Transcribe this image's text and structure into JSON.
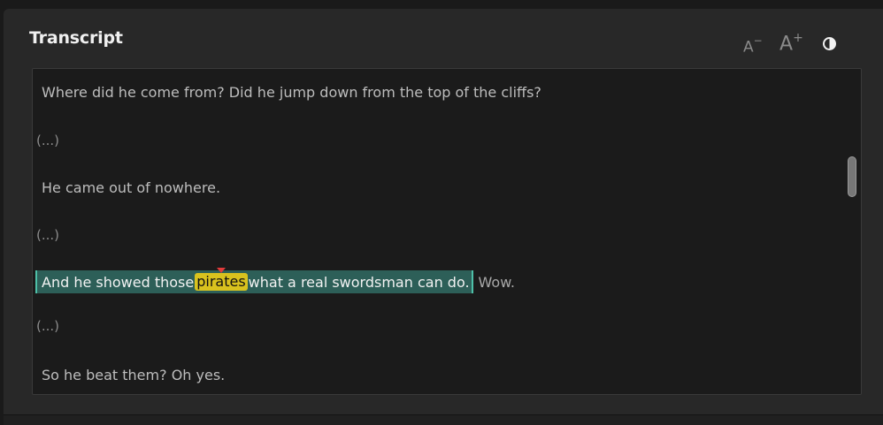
{
  "panel": {
    "title": "Transcript"
  },
  "toolbar": {
    "smaller_label": "A",
    "smaller_sup": "−",
    "larger_label": "A",
    "larger_sup": "+",
    "contrast_icon": "contrast-icon"
  },
  "transcript": {
    "lines": [
      "Where did he come from? Did he jump down from the top of the cliffs?",
      "(...)",
      "He came out of nowhere.",
      "(...)",
      "",
      "(...)",
      "So he beat them? Oh yes."
    ],
    "selected": {
      "before": "And he showed those",
      "highlight": "pirates",
      "after_in_selection": "what a real swordsman can do.",
      "after": "Wow."
    }
  },
  "colors": {
    "selection": "#2d5f58",
    "highlight": "#d9c21e",
    "marker": "#e23b3b"
  }
}
